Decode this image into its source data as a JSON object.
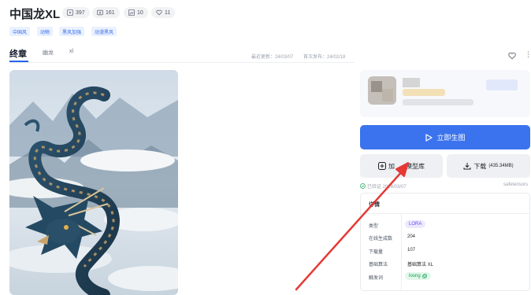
{
  "header": {
    "title": "中国龙XL",
    "stats": [
      {
        "icon": "play-icon",
        "value": "397"
      },
      {
        "icon": "download-stat-icon",
        "value": "161"
      },
      {
        "icon": "image-icon",
        "value": "10"
      },
      {
        "icon": "heart-icon",
        "value": "11"
      }
    ],
    "tags": [
      "中国风",
      "动物",
      "黑风加强",
      "动漫黑风"
    ]
  },
  "tabs": [
    "终章",
    "幽龙",
    "xl"
  ],
  "dates": {
    "updated": "最近更新：24/03/07",
    "published": "首次发布：24/02/18"
  },
  "actions": {
    "generate_label": "立即生图",
    "add_label_prefix": "加",
    "add_label_suffix": "模型库",
    "download_label": "下载",
    "download_size": "(435.34MB)"
  },
  "meta": {
    "left": "已验证 2024/03/07",
    "right": "safetensors"
  },
  "details": {
    "heading": "详情",
    "rows": [
      {
        "label": "类型",
        "value": "LORA"
      },
      {
        "label": "在线生成数",
        "value": "204"
      },
      {
        "label": "下载量",
        "value": "107"
      },
      {
        "label": "基础算法",
        "value": "基础算法 XL"
      },
      {
        "label": "触发词",
        "value": "loong"
      }
    ]
  },
  "colors": {
    "primary": "#3b73ee",
    "annotation_arrow": "#e53935"
  }
}
